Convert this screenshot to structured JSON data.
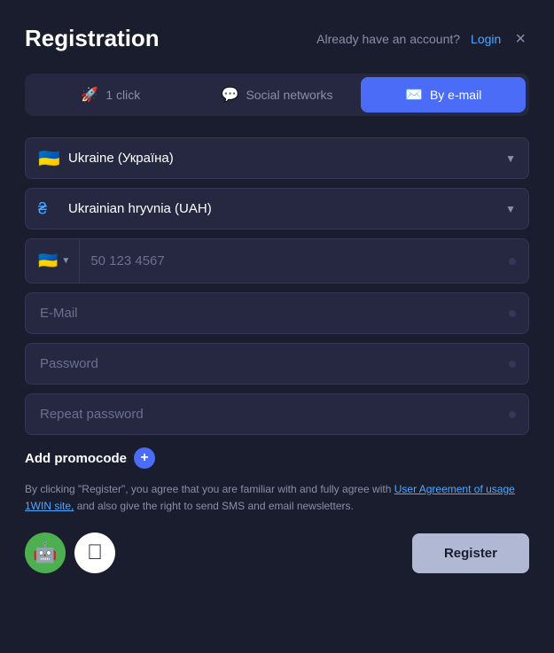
{
  "header": {
    "title": "Registration",
    "already_text": "Already have an account?",
    "login_label": "Login",
    "close_label": "×"
  },
  "tabs": [
    {
      "id": "one-click",
      "label": "1 click",
      "icon": "🚀",
      "active": false
    },
    {
      "id": "social",
      "label": "Social networks",
      "icon": "💬",
      "active": false
    },
    {
      "id": "email",
      "label": "By e-mail",
      "icon": "✉️",
      "active": true
    }
  ],
  "form": {
    "country_value": "Ukraine (Україна)",
    "currency_value": "Ukrainian hryvnia (UAH)",
    "phone_placeholder": "50 123 4567",
    "phone_flag": "🇺🇦",
    "email_placeholder": "E-Mail",
    "password_placeholder": "Password",
    "repeat_password_placeholder": "Repeat password"
  },
  "promo": {
    "label": "Add promocode",
    "plus": "+"
  },
  "terms": {
    "text_before": "By clicking \"Register\", you agree that you are familiar with and fully agree with",
    "link_text": "User Agreement of usage 1WIN site,",
    "text_after": "and also give the right to send SMS and email newsletters."
  },
  "bottom": {
    "android_icon": "🤖",
    "apple_icon": "",
    "register_label": "Register"
  }
}
